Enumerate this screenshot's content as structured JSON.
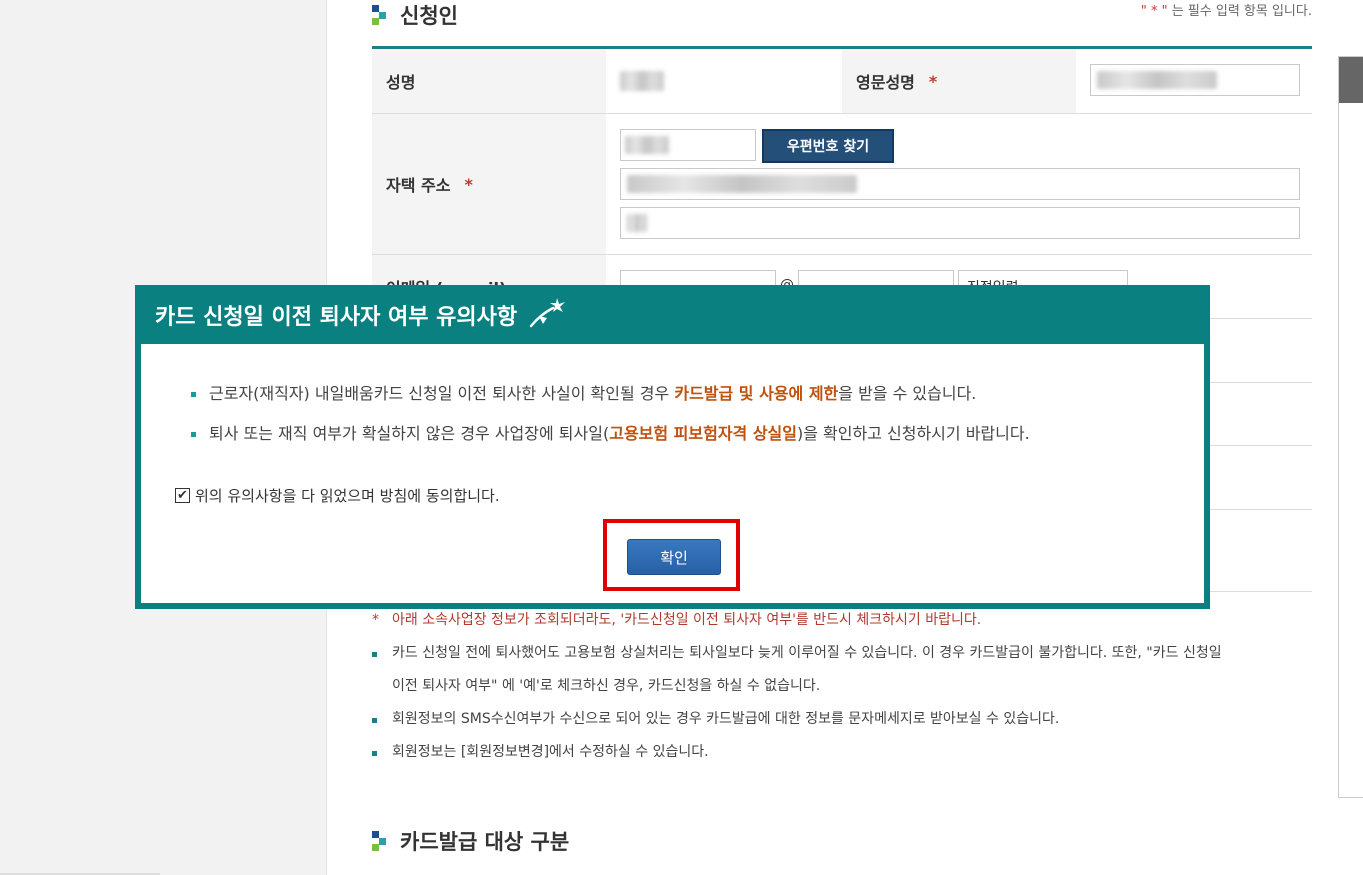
{
  "applicant_section": {
    "title": "신청인",
    "required_note_star": "\" * \"",
    "required_note_text": " 는 필수 입력 항목 입니다."
  },
  "form": {
    "name_label": "성명",
    "eng_name_label": "영문성명",
    "address_label": "자택 주소",
    "zip_button": "우편번호 찾기",
    "email_label": "이메일 (e-mail)",
    "email_at": "@",
    "email_select": "직접입력",
    "required_star": "*"
  },
  "notes": [
    "아래 소속사업장 정보가 조회되더라도, '카드신청일 이전 퇴사자 여부'를 반드시 체크하시기 바랍니다.",
    "카드 신청일 전에 퇴사했어도 고용보험 상실처리는 퇴사일보다 늦게 이루어질 수 있습니다. 이 경우 카드발급이 불가합니다. 또한, \"카드 신청일",
    "이전 퇴사자 여부\" 에 '예'로 체크하신 경우, 카드신청을 하실 수 없습니다.",
    "회원정보의 SMS수신여부가 수신으로 되어 있는 경우 카드발급에 대한 정보를 문자메세지로 받아보실 수 있습니다.",
    "회원정보는 [회원정보변경]에서 수정하실 수 있습니다."
  ],
  "notes_warn_star": "*",
  "card_section": {
    "title": "카드발급 대상 구분"
  },
  "modal": {
    "title": "카드 신청일 이전 퇴사자 여부 유의사항",
    "item1_pre": "근로자(재직자) 내일배움카드 신청일 이전 퇴사한 사실이 확인될 경우 ",
    "item1_hl": "카드발급 및 사용에 제한",
    "item1_post": "을 받을 수 있습니다.",
    "item2_pre": "퇴사 또는 재직 여부가 확실하지 않은 경우 사업장에 퇴사일(",
    "item2_hl": "고용보험 피보험자격 상실일",
    "item2_post": ")을 확인하고 신청하시기 바랍니다.",
    "agree_text": "위의 유의사항을 다 읽었으며 방침에 동의합니다.",
    "agree_checked": true,
    "confirm_label": "확인"
  },
  "colors": {
    "modal_teal": "#0a8080",
    "highlight": "#c0510d",
    "confirm_blue": "#2f6db5",
    "focus_red": "#e00000"
  }
}
